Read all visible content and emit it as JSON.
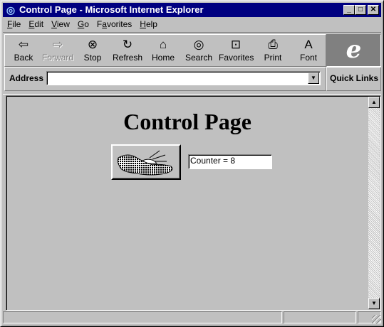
{
  "window": {
    "title": "Control Page - Microsoft Internet Explorer"
  },
  "menu": [
    {
      "label": "File",
      "key": "F",
      "rest": "ile"
    },
    {
      "label": "Edit",
      "key": "E",
      "rest": "dit"
    },
    {
      "label": "View",
      "key": "V",
      "rest": "iew"
    },
    {
      "label": "Go",
      "key": "G",
      "rest": "o"
    },
    {
      "label": "Favorites",
      "key": "a",
      "pre": "F",
      "rest": "vorites"
    },
    {
      "label": "Help",
      "key": "H",
      "rest": "elp"
    }
  ],
  "toolbar": {
    "back": "Back",
    "forward": "Forward",
    "stop": "Stop",
    "refresh": "Refresh",
    "home": "Home",
    "search": "Search",
    "favorites": "Favorites",
    "print": "Print",
    "font": "Font"
  },
  "address": {
    "label": "Address",
    "value": ""
  },
  "quick_links": "Quick Links",
  "page": {
    "heading": "Control Page",
    "counter_value": "Counter = 8"
  }
}
